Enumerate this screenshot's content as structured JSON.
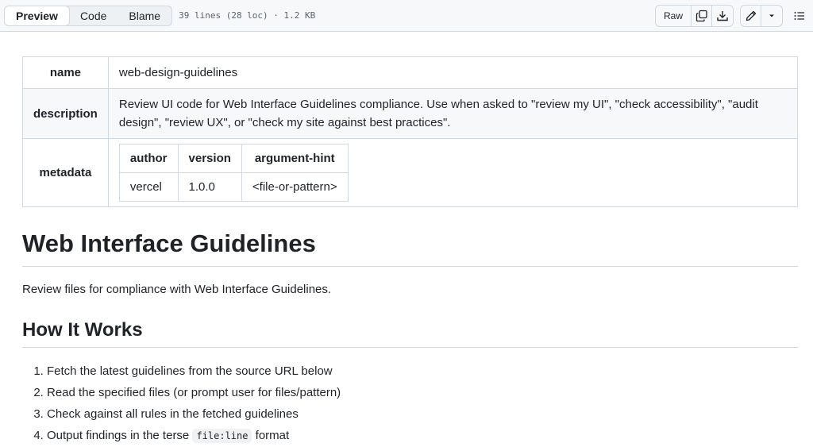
{
  "toolbar": {
    "tabs": [
      "Preview",
      "Code",
      "Blame"
    ],
    "file_info": "39 lines (28 loc) · 1.2 KB",
    "raw_label": "Raw",
    "icons": [
      "copy-icon",
      "download-icon",
      "pencil-icon",
      "chevron-down-icon",
      "list-icon"
    ]
  },
  "meta": {
    "name_key": "name",
    "name_value": "web-design-guidelines",
    "description_key": "description",
    "description_value": "Review UI code for Web Interface Guidelines compliance. Use when asked to \"review my UI\", \"check accessibility\", \"audit design\", \"review UX\", or \"check my site against best practices\".",
    "metadata_key": "metadata",
    "metadata_table": {
      "headers": [
        "author",
        "version",
        "argument-hint"
      ],
      "values": [
        "vercel",
        "1.0.0",
        "<file-or-pattern>"
      ]
    }
  },
  "doc": {
    "title": "Web Interface Guidelines",
    "lead": "Review files for compliance with Web Interface Guidelines.",
    "section_title": "How It Works",
    "steps": [
      "Fetch the latest guidelines from the source URL below",
      "Read the specified files (or prompt user for files/pattern)",
      "Check against all rules in the fetched guidelines"
    ],
    "step4_before": "Output findings in the terse",
    "step4_code": "file:line",
    "step4_after": "format"
  },
  "colors": {
    "border": "#d1d9e0",
    "toolbar_bg": "#f6f8fa",
    "text": "#1f2328",
    "muted": "#59636e"
  }
}
